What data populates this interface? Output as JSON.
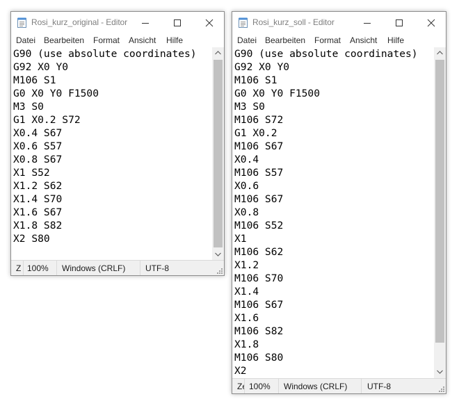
{
  "windows": [
    {
      "title": "Rosi_kurz_original - Editor",
      "menu": [
        "Datei",
        "Bearbeiten",
        "Format",
        "Ansicht",
        "Hilfe"
      ],
      "lines": [
        "G90 (use absolute coordinates)",
        "G92 X0 Y0",
        "M106 S1",
        "G0 X0 Y0 F1500",
        "M3 S0",
        "G1 X0.2 S72",
        "X0.4 S67",
        "X0.6 S57",
        "X0.8 S67",
        "X1 S52",
        "X1.2 S62",
        "X1.4 S70",
        "X1.6 S67",
        "X1.8 S82",
        "X2 S80"
      ],
      "status": {
        "position": "Z",
        "zoom": "100%",
        "line_ending": "Windows (CRLF)",
        "encoding": "UTF-8"
      }
    },
    {
      "title": "Rosi_kurz_soll - Editor",
      "menu": [
        "Datei",
        "Bearbeiten",
        "Format",
        "Ansicht",
        "Hilfe"
      ],
      "lines": [
        "G90 (use absolute coordinates)",
        "G92 X0 Y0",
        "M106 S1",
        "G0 X0 Y0 F1500",
        "M3 S0",
        "M106 S72",
        "G1 X0.2",
        "M106 S67",
        "X0.4",
        "M106 S57",
        "X0.6",
        "M106 S67",
        "X0.8",
        "M106 S52",
        "X1",
        "M106 S62",
        "X1.2",
        "M106 S70",
        "X1.4",
        "M106 S67",
        "X1.6",
        "M106 S82",
        "X1.8",
        "M106 S80",
        "X2"
      ],
      "status": {
        "position": "Ze",
        "zoom": "100%",
        "line_ending": "Windows (CRLF)",
        "encoding": "UTF-8"
      }
    }
  ],
  "icons": {
    "app": "notepad-icon",
    "minimize": "minimize-icon",
    "maximize": "maximize-icon",
    "close": "close-icon",
    "scroll_up": "chevron-up-icon",
    "scroll_down": "chevron-down-icon",
    "resize": "resize-grip-icon"
  },
  "colors": {
    "title_text": "#7f7f7f",
    "scrollbar_track": "#f0f0f0",
    "scrollbar_thumb": "#c1c1c1",
    "statusbar": "#f0f0f0"
  }
}
